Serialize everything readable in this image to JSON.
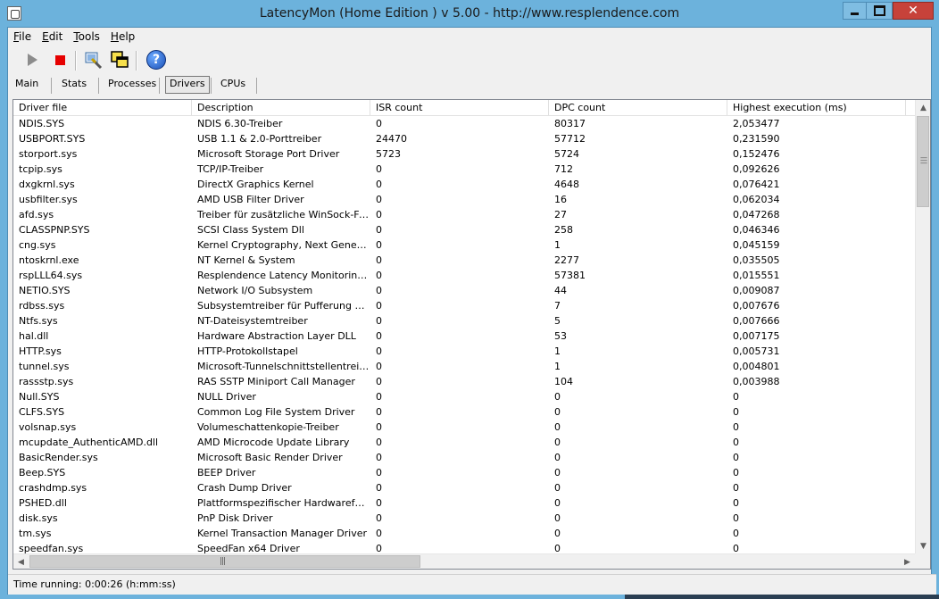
{
  "window": {
    "title": "LatencyMon  (Home Edition )  v 5.00 - http://www.resplendence.com"
  },
  "menu": [
    {
      "label": "File",
      "accel": "F",
      "rest": "ile"
    },
    {
      "label": "Edit",
      "accel": "E",
      "rest": "dit"
    },
    {
      "label": "Tools",
      "accel": "T",
      "rest": "ools"
    },
    {
      "label": "Help",
      "accel": "H",
      "rest": "elp"
    }
  ],
  "toolbar": {
    "icons": [
      "play-icon",
      "stop-icon",
      "driver-icon",
      "windows-icon",
      "help-icon"
    ],
    "help_glyph": "?"
  },
  "tabs": [
    "Main",
    "Stats",
    "Processes",
    "Drivers",
    "CPUs"
  ],
  "active_tab": "Drivers",
  "table": {
    "columns": [
      "Driver file",
      "Description",
      "ISR count",
      "DPC count",
      "Highest execution (ms)"
    ],
    "rows": [
      [
        "NDIS.SYS",
        "NDIS 6.30-Treiber",
        "0",
        "80317",
        "2,053477"
      ],
      [
        "USBPORT.SYS",
        "USB 1.1 & 2.0-Porttreiber",
        "24470",
        "57712",
        "0,231590"
      ],
      [
        "storport.sys",
        "Microsoft Storage Port Driver",
        "5723",
        "5724",
        "0,152476"
      ],
      [
        "tcpip.sys",
        "TCP/IP-Treiber",
        "0",
        "712",
        "0,092626"
      ],
      [
        "dxgkrnl.sys",
        "DirectX Graphics Kernel",
        "0",
        "4648",
        "0,076421"
      ],
      [
        "usbfilter.sys",
        "AMD USB Filter Driver",
        "0",
        "16",
        "0,062034"
      ],
      [
        "afd.sys",
        "Treiber für zusätzliche WinSock-Fun...",
        "0",
        "27",
        "0,047268"
      ],
      [
        "CLASSPNP.SYS",
        "SCSI Class System Dll",
        "0",
        "258",
        "0,046346"
      ],
      [
        "cng.sys",
        "Kernel Cryptography, Next Generation",
        "0",
        "1",
        "0,045159"
      ],
      [
        "ntoskrnl.exe",
        "NT Kernel & System",
        "0",
        "2277",
        "0,035505"
      ],
      [
        "rspLLL64.sys",
        "Resplendence Latency Monitoring a...",
        "0",
        "57381",
        "0,015551"
      ],
      [
        "NETIO.SYS",
        "Network I/O Subsystem",
        "0",
        "44",
        "0,009087"
      ],
      [
        "rdbss.sys",
        "Subsystemtreiber für Pufferung des ...",
        "0",
        "7",
        "0,007676"
      ],
      [
        "Ntfs.sys",
        "NT-Dateisystemtreiber",
        "0",
        "5",
        "0,007666"
      ],
      [
        "hal.dll",
        "Hardware Abstraction Layer DLL",
        "0",
        "53",
        "0,007175"
      ],
      [
        "HTTP.sys",
        "HTTP-Protokollstapel",
        "0",
        "1",
        "0,005731"
      ],
      [
        "tunnel.sys",
        "Microsoft-Tunnelschnittstellentreiber",
        "0",
        "1",
        "0,004801"
      ],
      [
        "rassstp.sys",
        "RAS SSTP Miniport Call Manager",
        "0",
        "104",
        "0,003988"
      ],
      [
        "Null.SYS",
        "NULL Driver",
        "0",
        "0",
        "0"
      ],
      [
        "CLFS.SYS",
        "Common Log File System Driver",
        "0",
        "0",
        "0"
      ],
      [
        "volsnap.sys",
        "Volumeschattenkopie-Treiber",
        "0",
        "0",
        "0"
      ],
      [
        "mcupdate_AuthenticAMD.dll",
        "AMD Microcode Update Library",
        "0",
        "0",
        "0"
      ],
      [
        "BasicRender.sys",
        "Microsoft Basic Render Driver",
        "0",
        "0",
        "0"
      ],
      [
        "Beep.SYS",
        "BEEP Driver",
        "0",
        "0",
        "0"
      ],
      [
        "crashdmp.sys",
        "Crash Dump Driver",
        "0",
        "0",
        "0"
      ],
      [
        "PSHED.dll",
        "Plattformspezifischer Hardwarefehle...",
        "0",
        "0",
        "0"
      ],
      [
        "disk.sys",
        "PnP Disk Driver",
        "0",
        "0",
        "0"
      ],
      [
        "tm.sys",
        "Kernel Transaction Manager Driver",
        "0",
        "0",
        "0"
      ],
      [
        "speedfan.sys",
        "SpeedFan x64 Driver",
        "0",
        "0",
        "0"
      ]
    ]
  },
  "status": {
    "text": "Time running: 0:00:26  (h:mm:ss)"
  }
}
